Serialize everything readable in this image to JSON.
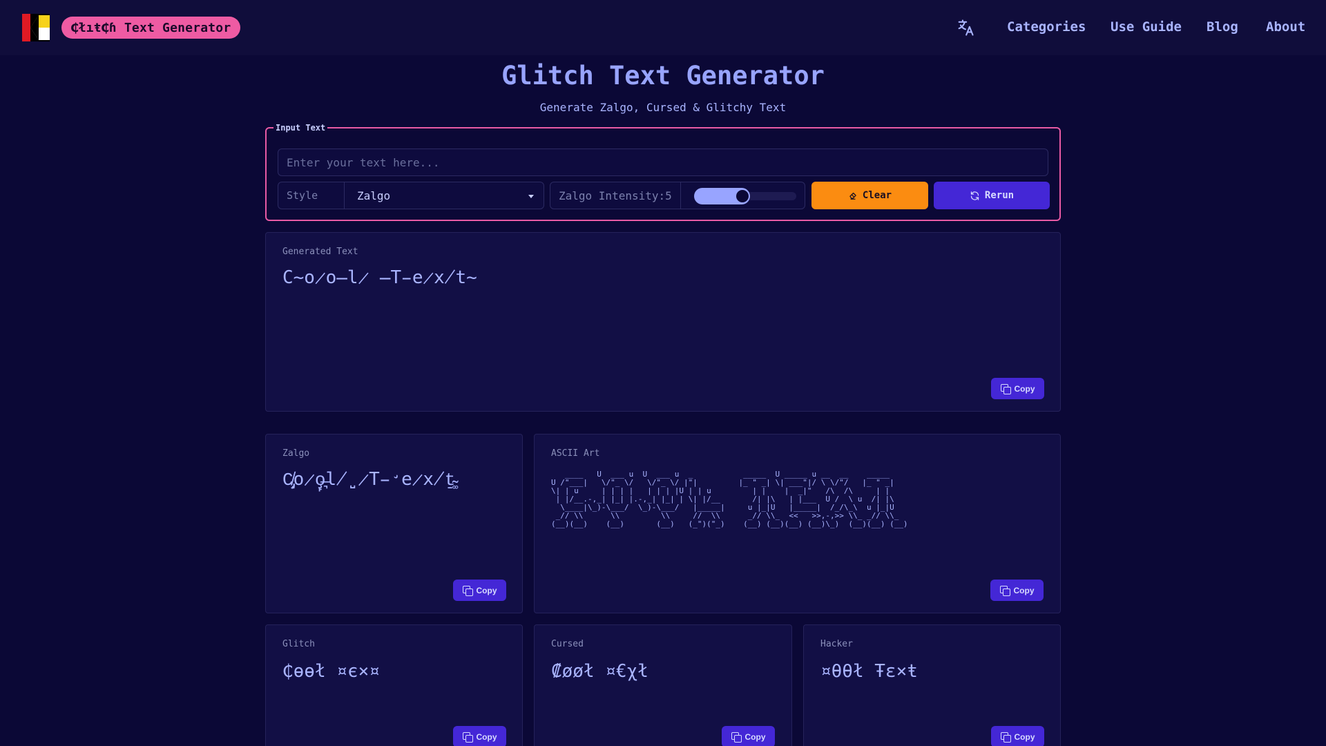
{
  "header": {
    "brand": "₵łıŧ₵ɦ Text Generator",
    "nav": [
      {
        "label": "Categories"
      },
      {
        "label": "Use Guide"
      },
      {
        "label": "Blog"
      },
      {
        "label": "About"
      }
    ]
  },
  "page": {
    "title": "Glitch Text Generator",
    "subtitle": "Generate Zalgo, Cursed & Glitchy Text"
  },
  "input": {
    "legend": "Input Text",
    "placeholder": "Enter your text here...",
    "value": "",
    "style_label": "Style",
    "style_value": "Zalgo",
    "intensity_label": "Zalgo Intensity:5",
    "intensity_fraction": 0.55,
    "clear_label": "Clear",
    "rerun_label": "Rerun"
  },
  "cards": {
    "generated": {
      "label": "Generated Text",
      "text": "C̴o̷o̶l̷ ̶T̵e̷x̸t̴",
      "copy": "Copy"
    },
    "zalgo": {
      "label": "Zalgo",
      "text": "C̸̡͔o̷̧̙o̶͉l̸̺ ̷T̵̛e̷x̸̠t̴͚",
      "copy": "Copy"
    },
    "ascii": {
      "label": "ASCII Art",
      "art": "   ____   U  ___ u  U  ___ u  _           _____  U _____ u __  __    _____  \nU /\"___|   \\/\"_ \\/   \\/\"_ \\/ |\"|         |_ \" _| \\| ___\"|/ \\ \\/\"/   |_ \" _| \n\\| | u     | | | |   | | | |U | | u         | |    |  _|\"   /\\  /\\     | |   \n | |/__.-,_| |_| |.-,_| |_| | \\| |/__       /| |\\   | |___  U /  \\ u  /| |\\  \n  \\____|\\_)-\\___/  \\_)-\\___/   |_____|     u |_|U   |_____|  /_/\\_\\  u |_|U  \n _// \\\\      \\\\         \\\\     //  \\\\      _// \\\\_  <<   >>,-,>> \\\\_ _// \\\\_ \n(__)(__)    (__)       (__)   (_\")(\"_)    (__) (__)(__) (__)\\_)  (__)(__) (__)",
      "copy": "Copy"
    },
    "glitch": {
      "label": "Glitch",
      "text": "₵ɵɵł ¤є×¤",
      "copy": "Copy"
    },
    "cursed": {
      "label": "Cursed",
      "text": "₡øøł ¤€χł",
      "copy": "Copy"
    },
    "hacker": {
      "label": "Hacker",
      "text": "¤θθł Ŧɛ×ŧ",
      "copy": "Copy"
    }
  },
  "colors": {
    "background": "#0b0836",
    "accent_pink": "#ee5ba3",
    "accent_orange": "#fb8c11",
    "accent_purple": "#4427d6",
    "text": "#a9b4ff"
  },
  "icons": [
    "logo-icon",
    "translate-icon",
    "eraser-icon",
    "refresh-icon",
    "copy-icon"
  ]
}
